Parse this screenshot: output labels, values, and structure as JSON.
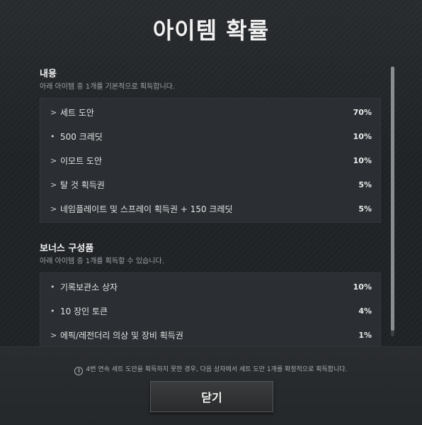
{
  "title": "아이템 확률",
  "sections": [
    {
      "title": "내용",
      "desc": "아래 아이템 중 1개를 기본적으로 획득합니다.",
      "items": [
        {
          "mark": ">",
          "name": "세트 도안",
          "pct": "70%"
        },
        {
          "mark": "•",
          "name": "500 크레딧",
          "pct": "10%"
        },
        {
          "mark": ">",
          "name": "이모트 도안",
          "pct": "10%"
        },
        {
          "mark": ">",
          "name": "탈 것 획득권",
          "pct": "5%"
        },
        {
          "mark": ">",
          "name": "네임플레이트 및 스프레이 획득권 + 150 크레딧",
          "pct": "5%"
        }
      ]
    },
    {
      "title": "보너스 구성품",
      "desc": "아래 아이템 중 1개를 획득할 수 있습니다.",
      "items": [
        {
          "mark": "•",
          "name": "기록보관소 상자",
          "pct": "10%"
        },
        {
          "mark": "•",
          "name": "10 장인 토큰",
          "pct": "4%"
        },
        {
          "mark": ">",
          "name": "에픽/레전더리 의상 및 장비 획득권",
          "pct": "1%"
        }
      ]
    }
  ],
  "notice": "4번 연속 세트 도안을 획득하지 못한 경우, 다음 상자에서 세트 도안 1개를 확정적으로 획득합니다.",
  "notice_icon": "info-icon",
  "close_label": "닫기"
}
